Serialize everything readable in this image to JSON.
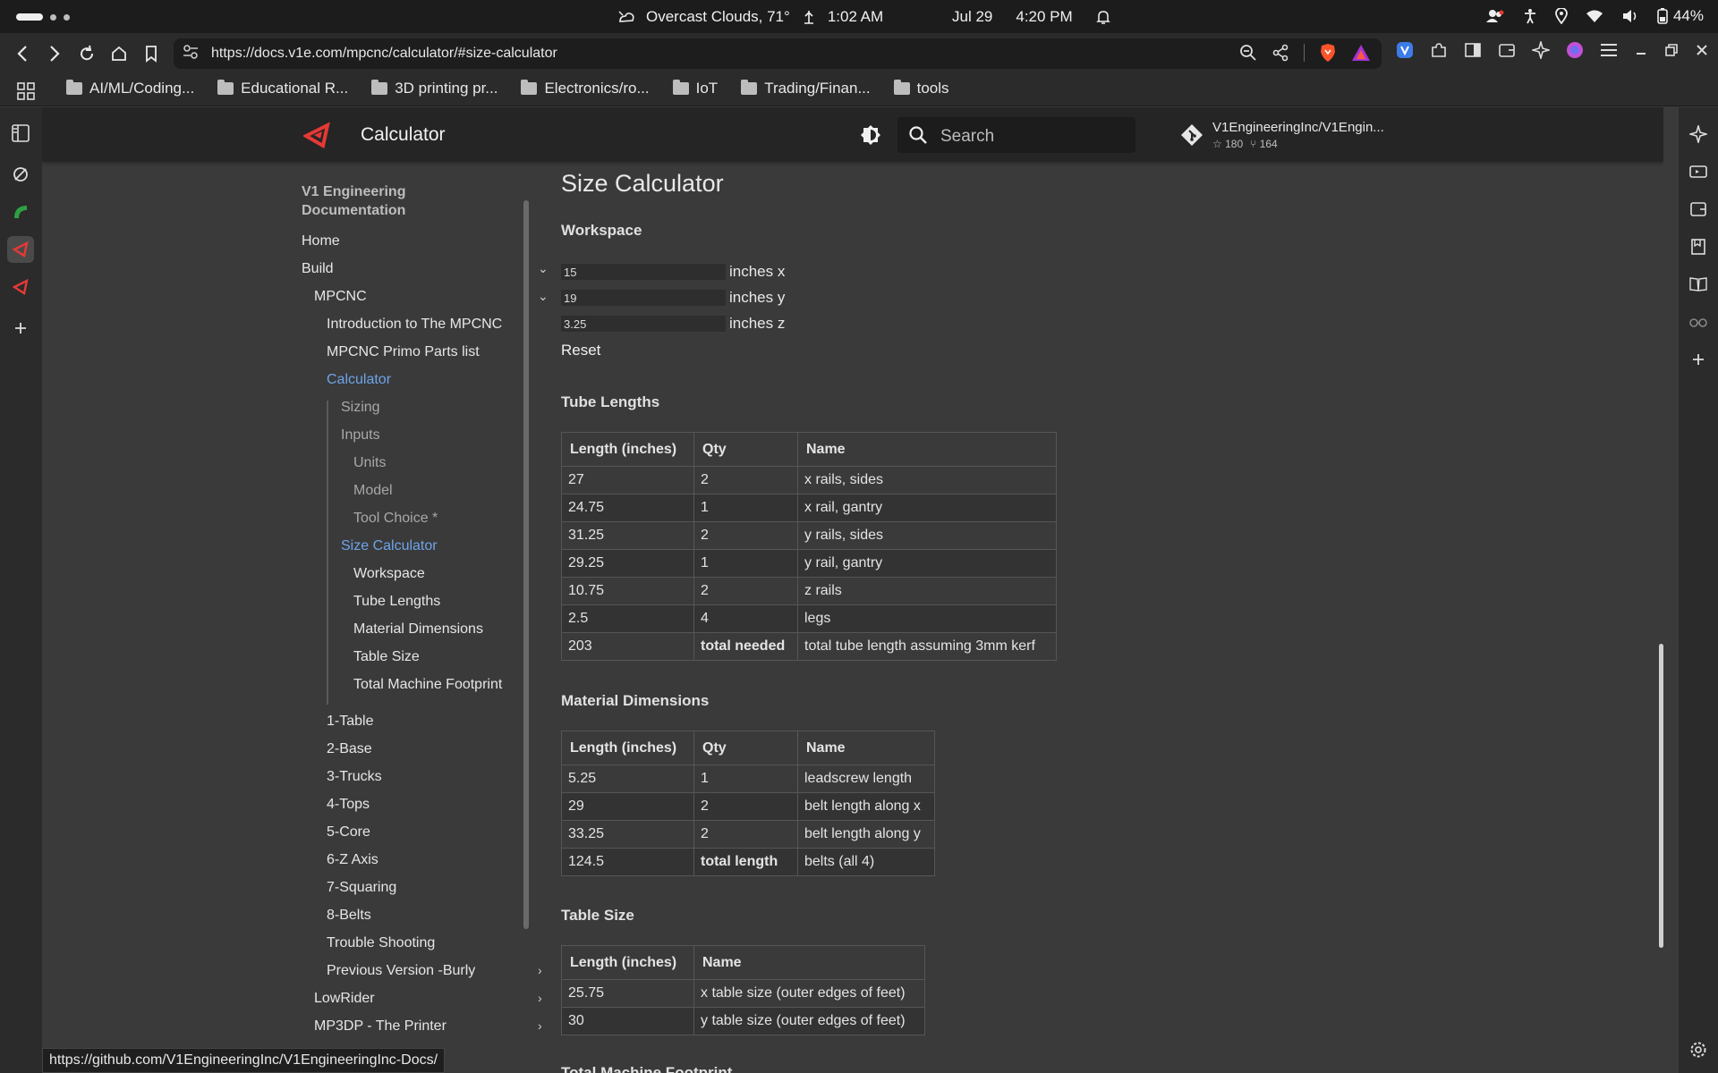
{
  "os": {
    "weather": "Overcast Clouds, 71°",
    "time": "1:02 AM",
    "date": "Jul 29",
    "clock": "4:20 PM",
    "battery": "44%"
  },
  "browser": {
    "url": "https://docs.v1e.com/mpcnc/calculator/#size-calculator",
    "bookmarks": [
      {
        "label": "AI/ML/Coding..."
      },
      {
        "label": "Educational R..."
      },
      {
        "label": "3D printing pr..."
      },
      {
        "label": "Electronics/ro..."
      },
      {
        "label": "IoT"
      },
      {
        "label": "Trading/Finan..."
      },
      {
        "label": "tools"
      }
    ],
    "status_url": "https://github.com/V1EngineeringInc/V1EngineeringInc-Docs/"
  },
  "header": {
    "title": "Calculator",
    "search_placeholder": "Search",
    "repo_name": "V1EngineeringInc/V1Engin...",
    "repo_stars": "180",
    "repo_forks": "164",
    "brand_color": "#e53935"
  },
  "nav": {
    "title_line1": "V1 Engineering",
    "title_line2": "Documentation",
    "items": [
      {
        "label": "Home"
      },
      {
        "label": "Build"
      },
      {
        "label": "MPCNC"
      },
      {
        "label": "Introduction to The MPCNC"
      },
      {
        "label": "MPCNC Primo Parts list"
      },
      {
        "label": "Calculator"
      },
      {
        "label": "Sizing"
      },
      {
        "label": "Inputs"
      },
      {
        "label": "Units"
      },
      {
        "label": "Model"
      },
      {
        "label": "Tool Choice *"
      },
      {
        "label": "Size Calculator"
      },
      {
        "label": "Workspace"
      },
      {
        "label": "Tube Lengths"
      },
      {
        "label": "Material Dimensions"
      },
      {
        "label": "Table Size"
      },
      {
        "label": "Total Machine Footprint"
      },
      {
        "label": "1-Table"
      },
      {
        "label": "2-Base"
      },
      {
        "label": "3-Trucks"
      },
      {
        "label": "4-Tops"
      },
      {
        "label": "5-Core"
      },
      {
        "label": "6-Z Axis"
      },
      {
        "label": "7-Squaring"
      },
      {
        "label": "8-Belts"
      },
      {
        "label": "Trouble Shooting"
      },
      {
        "label": "Previous Version -Burly"
      },
      {
        "label": "LowRider"
      },
      {
        "label": "MP3DP - The Printer"
      }
    ]
  },
  "content": {
    "page_title": "Size Calculator",
    "workspace": {
      "heading": "Workspace",
      "x_value": "15",
      "x_label": "inches x",
      "y_value": "19",
      "y_label": "inches y",
      "z_value": "3.25",
      "z_label": "inches z",
      "reset": "Reset"
    },
    "tube": {
      "heading": "Tube Lengths",
      "headers": [
        "Length (inches)",
        "Qty",
        "Name"
      ],
      "rows": [
        [
          "27",
          "2",
          "x rails, sides"
        ],
        [
          "24.75",
          "1",
          "x rail, gantry"
        ],
        [
          "31.25",
          "2",
          "y rails, sides"
        ],
        [
          "29.25",
          "1",
          "y rail, gantry"
        ],
        [
          "10.75",
          "2",
          "z rails"
        ],
        [
          "2.5",
          "4",
          "legs"
        ],
        [
          "203",
          "total needed",
          "total tube length assuming 3mm kerf"
        ]
      ]
    },
    "material": {
      "heading": "Material Dimensions",
      "headers": [
        "Length (inches)",
        "Qty",
        "Name"
      ],
      "rows": [
        [
          "5.25",
          "1",
          "leadscrew length"
        ],
        [
          "29",
          "2",
          "belt length along x"
        ],
        [
          "33.25",
          "2",
          "belt length along y"
        ],
        [
          "124.5",
          "total length",
          "belts (all 4)"
        ]
      ]
    },
    "table_size": {
      "heading": "Table Size",
      "headers": [
        "Length (inches)",
        "Name"
      ],
      "rows": [
        [
          "25.75",
          "x table size (outer edges of feet)"
        ],
        [
          "30",
          "y table size (outer edges of feet)"
        ]
      ]
    },
    "footprint_heading": "Total Machine Footprint"
  }
}
